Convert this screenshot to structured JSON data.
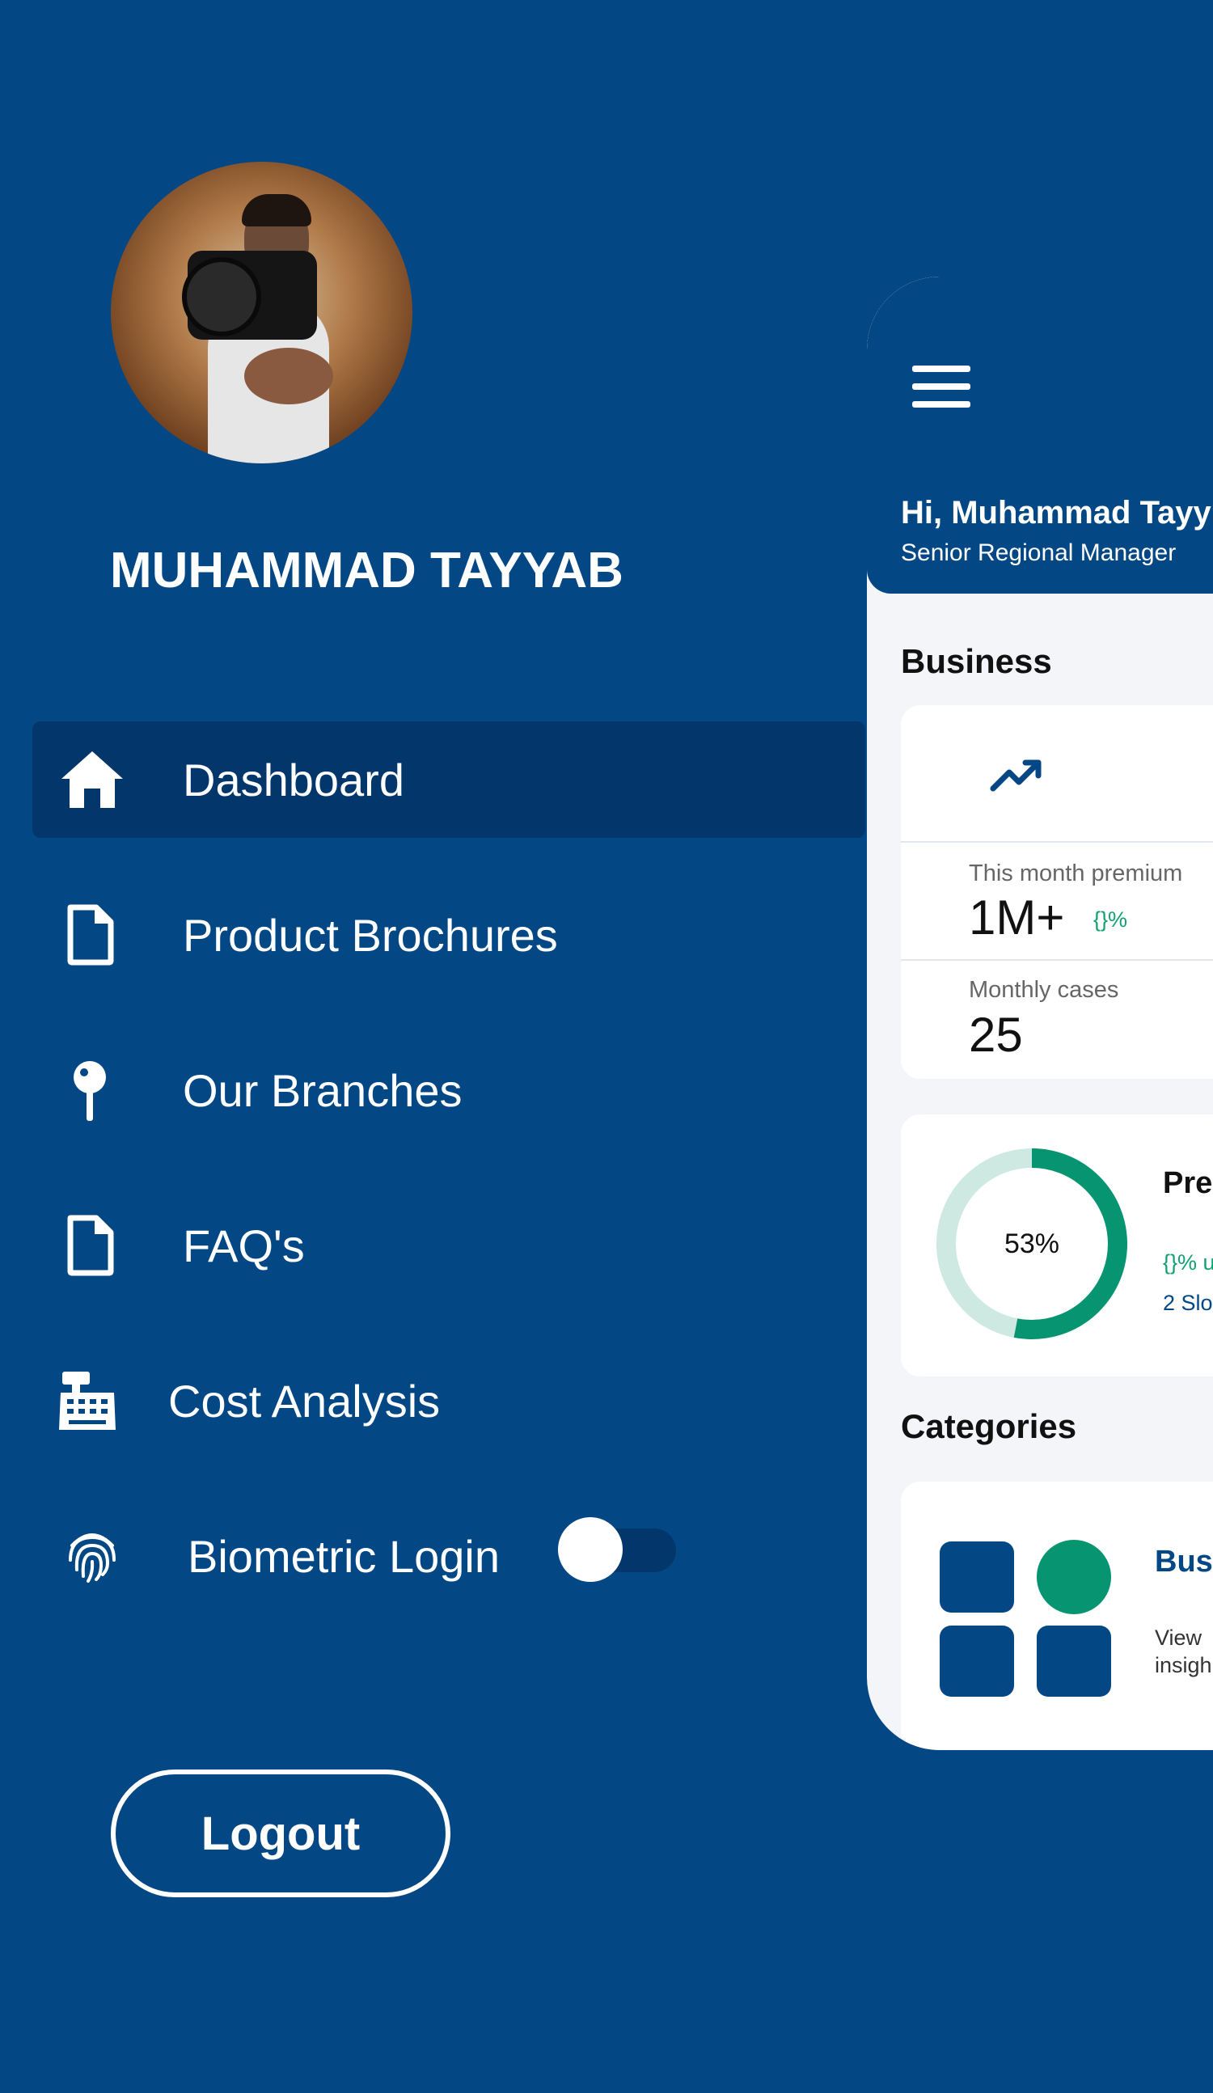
{
  "profile": {
    "name": "MUHAMMAD TAYYAB"
  },
  "menu": {
    "items": [
      {
        "label": "Dashboard",
        "icon": "home-icon",
        "active": true
      },
      {
        "label": "Product Brochures",
        "icon": "document-icon"
      },
      {
        "label": "Our Branches",
        "icon": "map-pin-icon"
      },
      {
        "label": "FAQ's",
        "icon": "document-icon"
      },
      {
        "label": "Cost Analysis",
        "icon": "cash-register-icon"
      },
      {
        "label": "Biometric Login",
        "icon": "fingerprint-icon"
      }
    ],
    "biometric_enabled": false
  },
  "logout": {
    "label": "Logout"
  },
  "dashboard": {
    "greeting": "Hi, Muhammad Tayy",
    "role": "Senior Regional Manager",
    "business": {
      "title": "Business",
      "premium_label": "This month premium",
      "premium_value": "1M+",
      "premium_change": "{}%",
      "cases_label": "Monthly cases",
      "cases_value": "25"
    },
    "progress": {
      "percent_text": "53%",
      "percent": 53,
      "title": "Pre",
      "line1": "{}% u",
      "line2": "2 Slo"
    },
    "categories": {
      "title": "Categories",
      "item_title": "Bus",
      "item_desc_1": "View",
      "item_desc_2": "insigh"
    }
  },
  "colors": {
    "background": "#034785",
    "active_item": "#03376b",
    "accent_green": "#079470",
    "donut_track": "#cde9e2"
  }
}
